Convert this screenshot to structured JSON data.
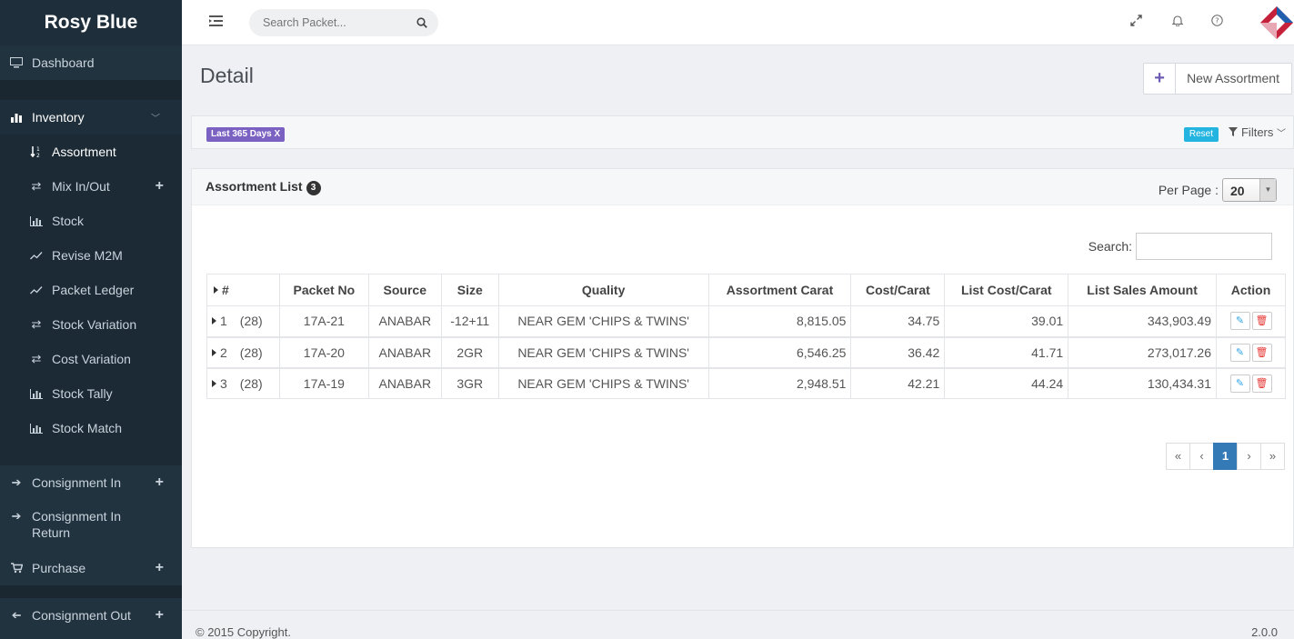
{
  "brand": "Rosy Blue",
  "sidebar": {
    "dashboard": "Dashboard",
    "inventory": "Inventory",
    "inventory_items": [
      {
        "label": "Assortment",
        "icon": "sort-numeric-icon",
        "active": true
      },
      {
        "label": "Mix In/Out",
        "icon": "exchange-icon",
        "plus": true
      },
      {
        "label": "Stock",
        "icon": "bar-chart-icon"
      },
      {
        "label": "Revise M2M",
        "icon": "line-chart-icon"
      },
      {
        "label": "Packet Ledger",
        "icon": "line-chart-icon"
      },
      {
        "label": "Stock Variation",
        "icon": "exchange-icon"
      },
      {
        "label": "Cost Variation",
        "icon": "exchange-icon"
      },
      {
        "label": "Stock Tally",
        "icon": "bar-chart-icon"
      },
      {
        "label": "Stock Match",
        "icon": "bar-chart-icon"
      }
    ],
    "consignment_in": "Consignment In",
    "consignment_in_return": "Consignment In Return",
    "purchase": "Purchase",
    "consignment_out": "Consignment Out"
  },
  "topbar": {
    "search_placeholder": "Search Packet..."
  },
  "page": {
    "title": "Detail",
    "new_button": "New Assortment"
  },
  "filters": {
    "chip": "Last 365 Days X",
    "reset": "Reset",
    "filters_label": "Filters"
  },
  "panel": {
    "title": "Assortment List",
    "count": "3",
    "per_page_label": "Per Page :",
    "per_page_value": "20",
    "search_label": "Search:"
  },
  "table": {
    "headers": [
      "#",
      "Packet No",
      "Source",
      "Size",
      "Quality",
      "Assortment Carat",
      "Cost/Carat",
      "List Cost/Carat",
      "List Sales Amount",
      "Action"
    ],
    "rows": [
      {
        "num": "1",
        "sub": "(28)",
        "packet": "17A-21",
        "source": "ANABAR",
        "size": "-12+11",
        "quality": "NEAR GEM 'CHIPS & TWINS'",
        "carat": "8,815.05",
        "cost": "34.75",
        "list_cost": "39.01",
        "sales": "343,903.49"
      },
      {
        "num": "2",
        "sub": "(28)",
        "packet": "17A-20",
        "source": "ANABAR",
        "size": "2GR",
        "quality": "NEAR GEM 'CHIPS & TWINS'",
        "carat": "6,546.25",
        "cost": "36.42",
        "list_cost": "41.71",
        "sales": "273,017.26"
      },
      {
        "num": "3",
        "sub": "(28)",
        "packet": "17A-19",
        "source": "ANABAR",
        "size": "3GR",
        "quality": "NEAR GEM 'CHIPS & TWINS'",
        "carat": "2,948.51",
        "cost": "42.21",
        "list_cost": "44.24",
        "sales": "130,434.31"
      }
    ]
  },
  "pager": {
    "first": "«",
    "prev": "‹",
    "current": "1",
    "next": "›",
    "last": "»"
  },
  "footer": {
    "copyright": "© 2015 Copyright.",
    "version": "2.0.0"
  }
}
